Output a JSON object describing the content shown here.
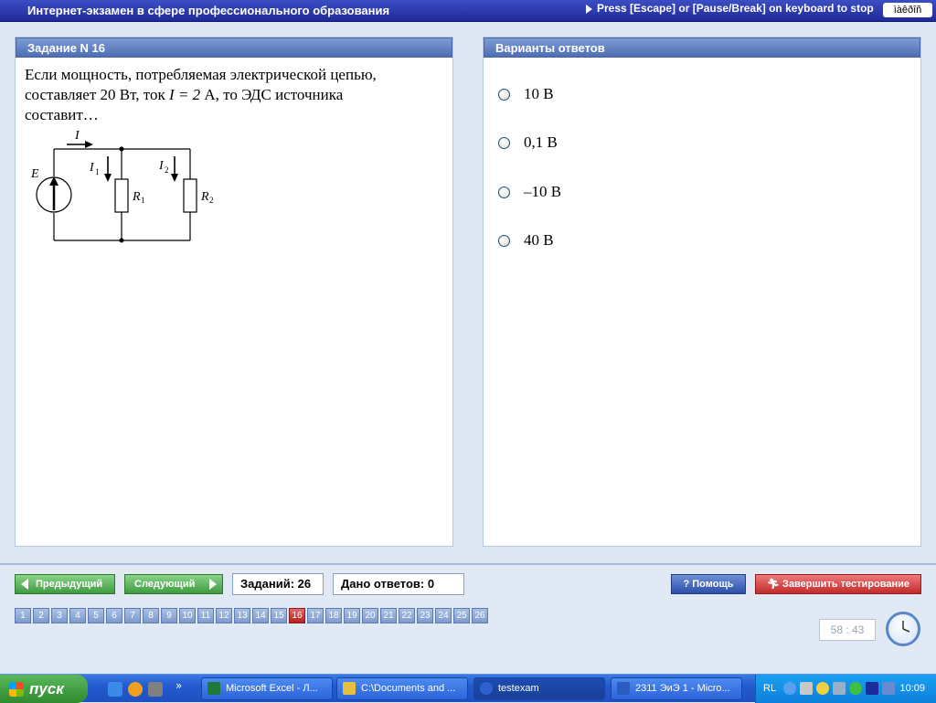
{
  "window": {
    "title": "Интернет-экзамен в сфере профессионального образования",
    "escape_hint": "Press [Escape] or [Pause/Break] on keyboard to stop",
    "lang_box": "ìàêðîñ"
  },
  "task": {
    "header": "Задание N 16",
    "text_1": "Если мощность, потребляемая электрической цепью,",
    "text_2a": "составляет 20 Вт, ток",
    "text_2_math": "I = 2",
    "text_2b": "А, то ЭДС источника",
    "text_3": "составит…",
    "circuit": {
      "current_total": "I",
      "emf": "E",
      "current_1": "I",
      "current_1_sub": "1",
      "current_2": "I",
      "current_2_sub": "2",
      "resistor_1": "R",
      "resistor_1_sub": "1",
      "resistor_2": "R",
      "resistor_2_sub": "2"
    }
  },
  "answers": {
    "header": "Варианты ответов",
    "options": [
      "10 В",
      "0,1 В",
      "–10 В",
      "40 В"
    ]
  },
  "toolbar": {
    "prev_label": "Предыдущий",
    "next_label": "Следующий",
    "tasks_count": "Заданий: 26",
    "answered_count": "Дано ответов: 0",
    "help_label": "Помощь",
    "finish_label": "Завершить тестирование",
    "pages": [
      "1",
      "2",
      "3",
      "4",
      "5",
      "6",
      "7",
      "8",
      "9",
      "10",
      "11",
      "12",
      "13",
      "14",
      "15",
      "16",
      "17",
      "18",
      "19",
      "20",
      "21",
      "22",
      "23",
      "24",
      "25",
      "26"
    ],
    "active_page": "16",
    "timer": "58 : 43"
  },
  "taskbar": {
    "start_label": "пуск",
    "items": [
      {
        "label": "Microsoft Excel - Л...",
        "icon_color": "#1d7a3a"
      },
      {
        "label": "C:\\Documents and ...",
        "icon_color": "#e8c040"
      },
      {
        "label": "testexam",
        "icon_color": "#3060d0"
      },
      {
        "label": "2311 ЭиЭ 1 - Micro...",
        "icon_color": "#2c5cc0"
      }
    ],
    "lang": "RL",
    "time": "10:09",
    "more_glyph": "»"
  }
}
